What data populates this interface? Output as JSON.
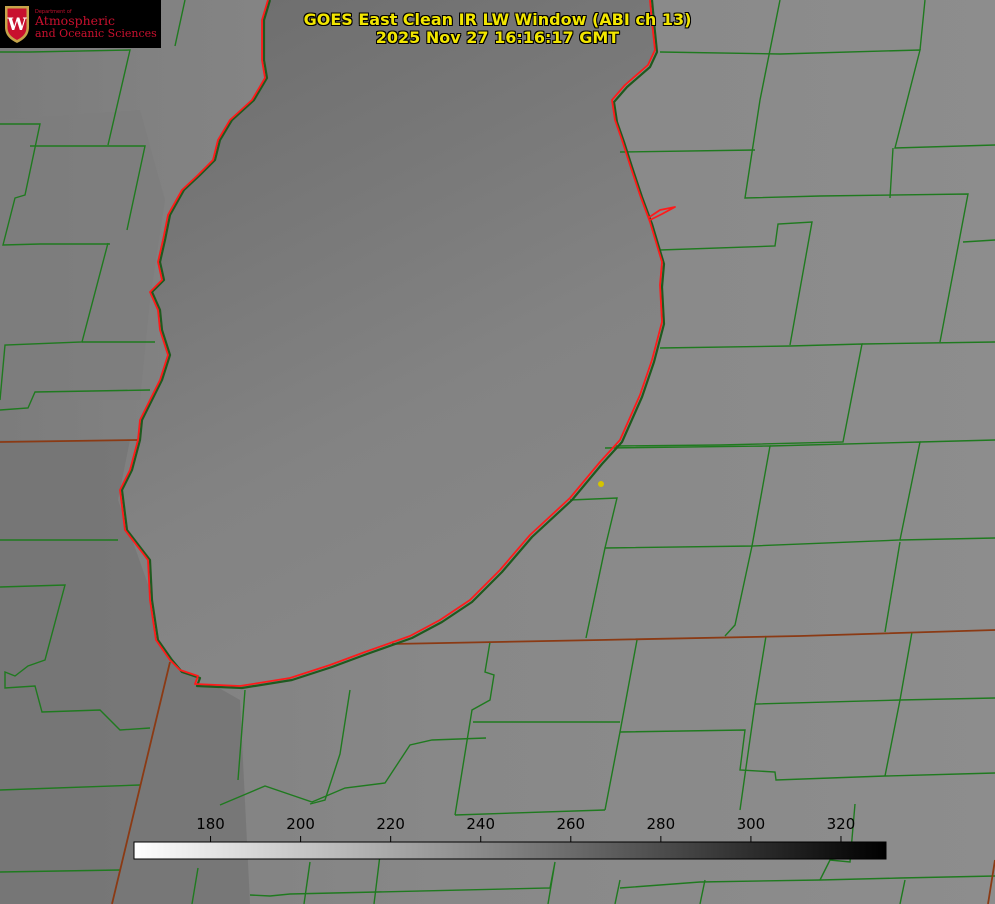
{
  "title": {
    "line1": "GOES East Clean IR LW Window (ABI ch 13)",
    "line2": "2025 Nov 27 16:16:17 GMT"
  },
  "logo": {
    "department": "Department of",
    "name_line1": "Atmospheric",
    "name_line2": "and Oceanic Sciences",
    "seal_letter": "W"
  },
  "colorbar": {
    "min": 163,
    "max": 330,
    "ticks": [
      "180",
      "200",
      "220",
      "240",
      "260",
      "280",
      "300",
      "320"
    ],
    "tick_values": [
      180,
      200,
      220,
      240,
      260,
      280,
      300,
      320
    ],
    "color_low": "#ffffff",
    "color_high": "#000000"
  },
  "colors": {
    "county_lines": "#1f7a1f",
    "state_lines": "#8b3a14",
    "shoreline": "#ff1a1a",
    "title_text": "#f2e600",
    "logo_text": "#c8102e",
    "marker": "#d4c400"
  }
}
